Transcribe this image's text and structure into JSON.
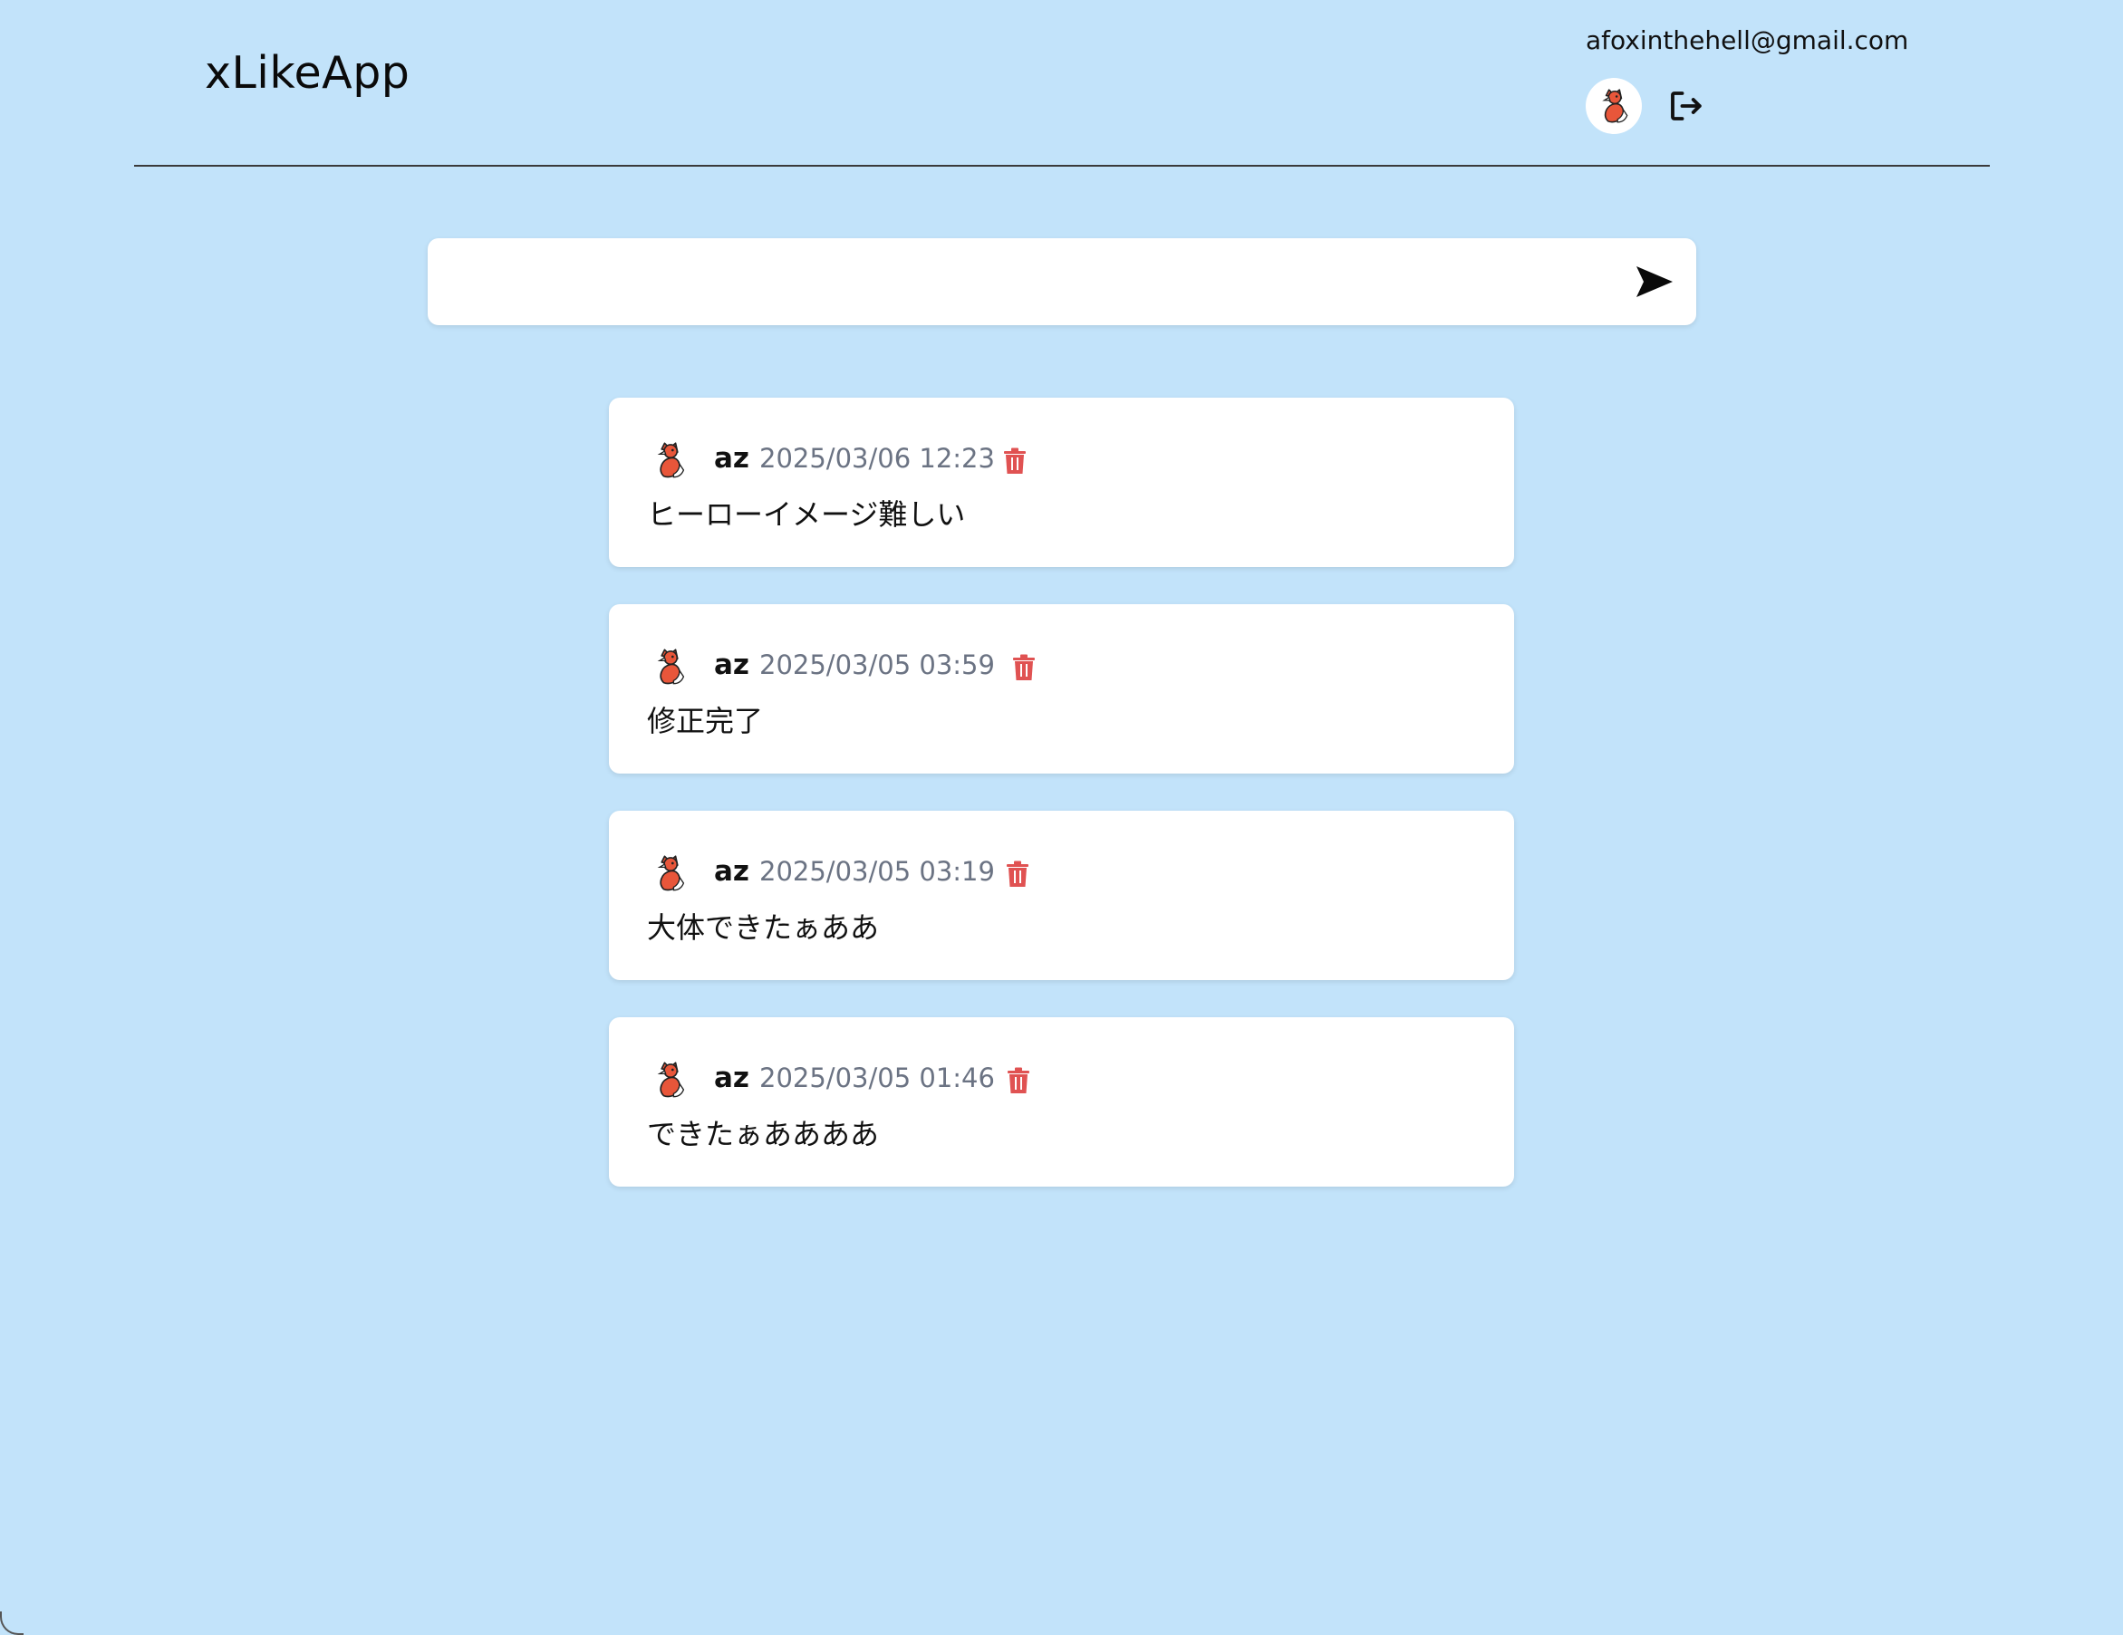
{
  "header": {
    "app_title": "xLikeApp",
    "user_email": "afoxinthehell@gmail.com"
  },
  "compose": {
    "placeholder": "",
    "value": ""
  },
  "posts": [
    {
      "author": "az",
      "time": "2025/03/06 12:23",
      "text": "ヒーローイメージ難しい"
    },
    {
      "author": "az",
      "time": "2025/03/05 03:59",
      "text": "修正完了"
    },
    {
      "author": "az",
      "time": "2025/03/05 03:19",
      "text": "大体できたぁああ"
    },
    {
      "author": "az",
      "time": "2025/03/05 01:46",
      "text": "できたぁああああ"
    }
  ],
  "icons": {
    "avatar": "fox-icon",
    "logout": "logout-icon",
    "send": "send-icon",
    "delete": "trash-icon"
  },
  "colors": {
    "background": "#c2e3fa",
    "card": "#ffffff",
    "delete_icon": "#e05252",
    "timestamp": "#6b7383"
  }
}
